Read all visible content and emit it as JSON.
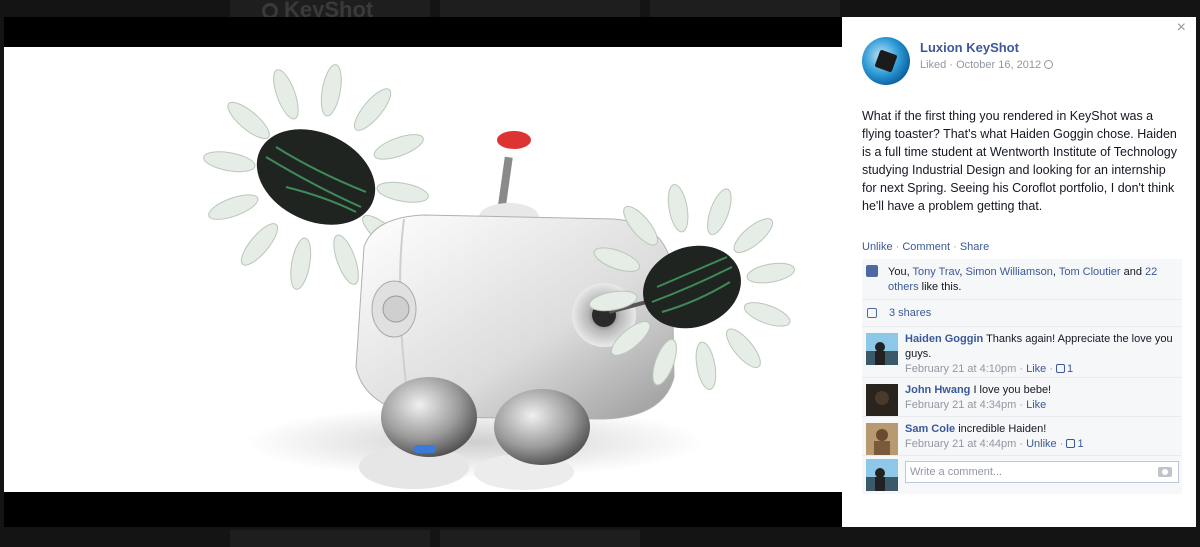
{
  "background": {
    "logo_text": "KeyShot"
  },
  "photo": {
    "subject_icon": "flying-toaster-render"
  },
  "panel": {
    "close_glyph": "×",
    "page": {
      "name": "Luxion KeyShot",
      "meta_liked": "Liked · October 16, 2012",
      "privacy_icon": "globe-icon"
    },
    "post_text": "What if the first thing you rendered in KeyShot was a flying toaster? That's what Haiden Goggin chose. Haiden is a full time student at Wentworth Institute of Technology studying Industrial Design and looking for an internship for next Spring. Seeing his Coroflot portfolio, I don't think he'll have a problem getting that.",
    "actions": {
      "unlike": "Unlike",
      "comment": "Comment",
      "share": "Share"
    },
    "likes": {
      "you": "You, ",
      "names": [
        "Tony Trav",
        "Simon Williamson",
        "Tom Cloutier"
      ],
      "and": " and ",
      "others": "22 others",
      "suffix": " like this."
    },
    "shares": "3 shares",
    "comments": [
      {
        "author": "Haiden Goggin",
        "text": " Thanks again! Appreciate the love you guys.",
        "time": "February 21 at 4:10pm",
        "action": "Like",
        "likes": "1"
      },
      {
        "author": "John Hwang",
        "text": " I love you bebe!",
        "time": "February 21 at 4:34pm",
        "action": "Like",
        "likes": ""
      },
      {
        "author": "Sam Cole",
        "text": " incredible Haiden!",
        "time": "February 21 at 4:44pm",
        "action": "Unlike",
        "likes": "1"
      }
    ],
    "write_comment_placeholder": "Write a comment..."
  },
  "colors": {
    "link": "#3b5998",
    "meta": "#9197a3",
    "panel_bg": "#ffffff",
    "feedback_bg": "#f6f7f9"
  }
}
